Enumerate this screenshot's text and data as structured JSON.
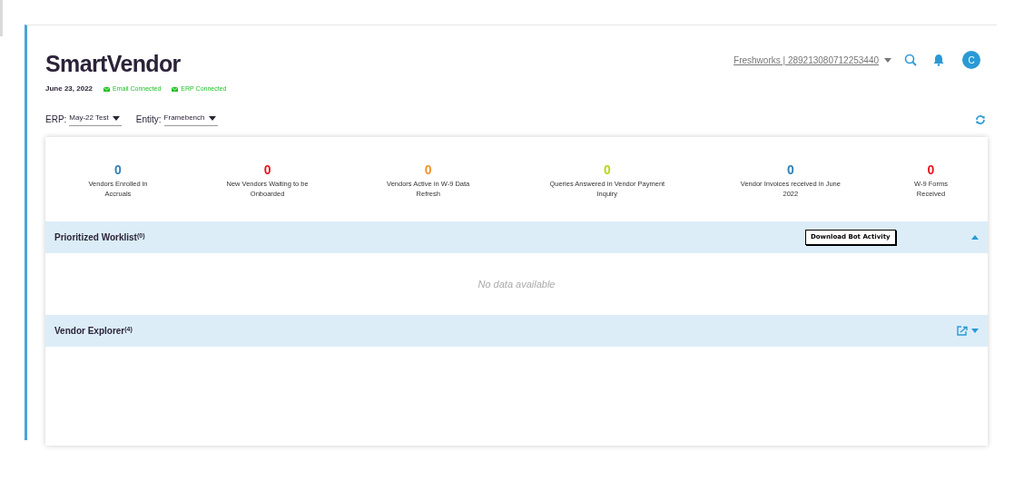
{
  "app": {
    "title": "SmartVendor",
    "date": "June 23, 2022",
    "connections": [
      {
        "label": "Email Connected",
        "connected": true
      },
      {
        "label": "ERP Connected",
        "connected": true
      }
    ]
  },
  "account": {
    "label": "Freshworks | 289213080712253440",
    "avatar": "C"
  },
  "filters": [
    {
      "label": "ERP:",
      "value": "May-22 Test"
    },
    {
      "label": "Entity:",
      "value": "Framebench"
    }
  ],
  "stats": [
    {
      "value": "0",
      "label": "Vendors Enrolled in Accruals",
      "color": "#2f7fb5"
    },
    {
      "value": "0",
      "label": "New Vendors Waiting to be Onboarded",
      "color": "#e8141b"
    },
    {
      "value": "0",
      "label": "Vendors Active in W-9 Data Refresh",
      "color": "#f0922b"
    },
    {
      "value": "0",
      "label": "Queries Answered in Vendor Payment Inquiry",
      "color": "#b6d61a"
    },
    {
      "value": "0",
      "label": "Vendor Invoices received in June 2022",
      "color": "#2f7fb5"
    },
    {
      "value": "0",
      "label": "W-9 Forms Received",
      "color": "#e8141b"
    }
  ],
  "sections": [
    {
      "title": "Prioritized Worklist$^{(0)}$",
      "kind": "worklist",
      "expanded": true,
      "tooltip": "Download Bot Activity",
      "empty_text": "No data available"
    },
    {
      "title": "Vendor Explorer$^{(4)}$",
      "kind": "explorer"
    }
  ]
}
